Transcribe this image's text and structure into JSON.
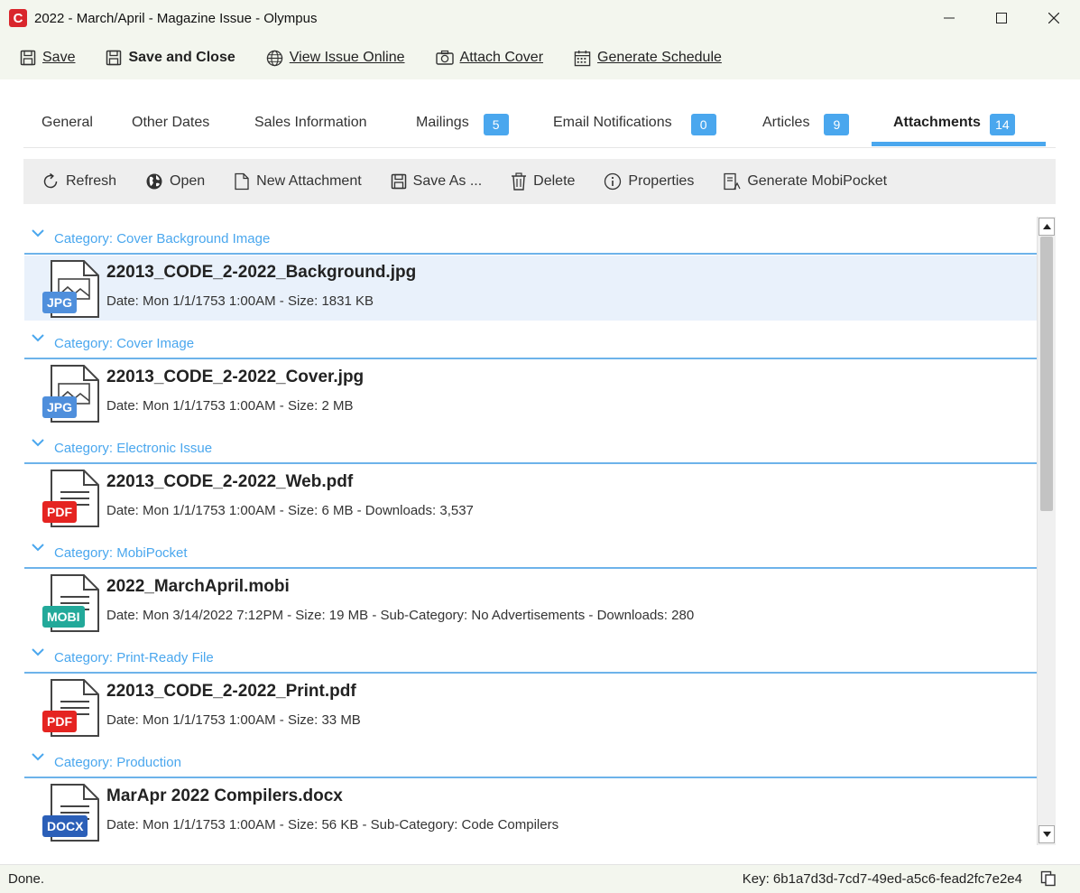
{
  "window": {
    "title": "2022 - March/April - Magazine Issue - Olympus",
    "logo_letter": "C",
    "controls": [
      "minimize-icon",
      "maximize-icon",
      "close-icon"
    ]
  },
  "toolbar": {
    "save": "Save",
    "save_close": "Save and Close",
    "view_online": "View Issue Online",
    "attach_cover": "Attach Cover",
    "generate_schedule": "Generate Schedule"
  },
  "tabs": [
    {
      "label": "General"
    },
    {
      "label": "Other Dates"
    },
    {
      "label": "Sales Information"
    },
    {
      "label": "Mailings",
      "badge": "5"
    },
    {
      "label": "Email Notifications",
      "badge": "0"
    },
    {
      "label": "Articles",
      "badge": "9"
    },
    {
      "label": "Attachments",
      "badge": "14",
      "active": true
    }
  ],
  "subtoolbar": {
    "refresh": "Refresh",
    "open": "Open",
    "new_attachment": "New Attachment",
    "save_as": "Save As ...",
    "delete": "Delete",
    "properties": "Properties",
    "generate_mobipocket": "Generate MobiPocket"
  },
  "attachments": [
    {
      "category": "Category:  Cover Background Image",
      "file_type": "JPG",
      "badge_color": "#4f8fdc",
      "name": "22013_CODE_2-2022_Background.jpg",
      "meta": "Date: Mon 1/1/1753 1:00AM - Size: 1831 KB",
      "selected": true
    },
    {
      "category": "Category:  Cover Image",
      "file_type": "JPG",
      "badge_color": "#4f8fdc",
      "name": "22013_CODE_2-2022_Cover.jpg",
      "meta": "Date: Mon 1/1/1753 1:00AM - Size: 2 MB"
    },
    {
      "category": "Category:  Electronic Issue",
      "file_type": "PDF",
      "badge_color": "#e52421",
      "name": "22013_CODE_2-2022_Web.pdf",
      "meta": "Date: Mon 1/1/1753 1:00AM - Size: 6 MB - Downloads: 3,537"
    },
    {
      "category": "Category:  MobiPocket",
      "file_type": "MOBI",
      "badge_color": "#22a99a",
      "name": "2022_MarchApril.mobi",
      "meta": "Date: Mon 3/14/2022 7:12PM - Size: 19 MB - Sub-Category: No Advertisements - Downloads: 280"
    },
    {
      "category": "Category:  Print-Ready File",
      "file_type": "PDF",
      "badge_color": "#e52421",
      "name": "22013_CODE_2-2022_Print.pdf",
      "meta": "Date: Mon 1/1/1753 1:00AM - Size: 33 MB"
    },
    {
      "category": "Category:  Production",
      "file_type": "DOCX",
      "badge_color": "#2b5fb8",
      "name": "MarApr 2022 Compilers.docx",
      "meta": "Date: Mon 1/1/1753 1:00AM - Size: 56 KB - Sub-Category: Code Compilers"
    }
  ],
  "statusbar": {
    "status": "Done.",
    "key": "Key: 6b1a7d3d-7cd7-49ed-a5c6-fead2fc7e2e4"
  },
  "colors": {
    "accent": "#4aa7ee",
    "category_text": "#4aa7ee",
    "selected_row": "#e9f1fb",
    "chrome": "#f3f6ee"
  }
}
